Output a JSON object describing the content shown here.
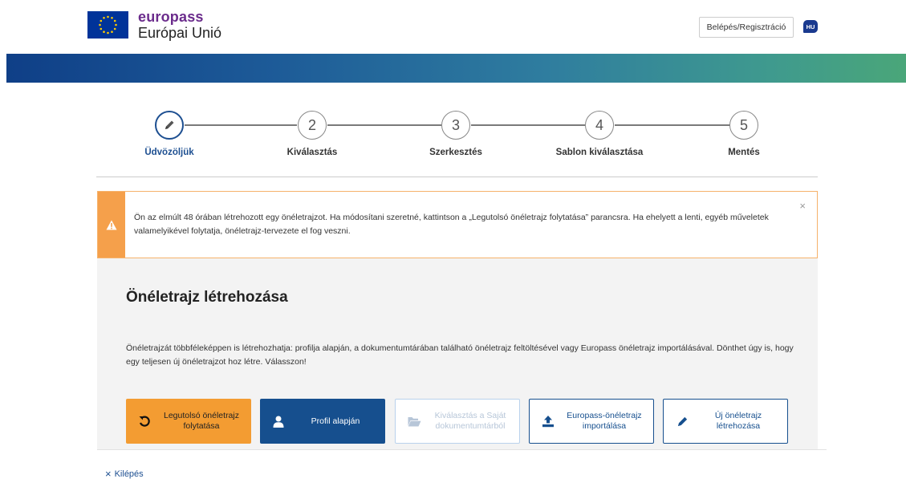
{
  "header": {
    "brand": "europass",
    "subtitle": "Európai Unió",
    "login_label": "Belépés/Regisztráció",
    "language": "HU"
  },
  "stepper": {
    "steps": [
      {
        "number": "",
        "label": "Üdvözöljük",
        "active": true
      },
      {
        "number": "2",
        "label": "Kiválasztás",
        "active": false
      },
      {
        "number": "3",
        "label": "Szerkesztés",
        "active": false
      },
      {
        "number": "4",
        "label": "Sablon kiválasztása",
        "active": false
      },
      {
        "number": "5",
        "label": "Mentés",
        "active": false
      }
    ]
  },
  "alert": {
    "text": "Ön az elmúlt 48 órában létrehozott egy önéletrajzot. Ha módosítani szeretné, kattintson a „Legutolsó önéletrajz folytatása” parancsra. Ha ehelyett a lenti, egyéb műveletek valamelyikével folytatja, önéletrajz-tervezete el fog veszni.",
    "close": "×"
  },
  "panel": {
    "title": "Önéletrajz létrehozása",
    "description": "Önéletrajzát többféleképpen is létrehozhatja: profilja alapján, a dokumentumtárában található önéletrajz feltöltésével vagy Europass önéletrajz importálásával. Dönthet úgy is, hogy egy teljesen új önéletrajzot hoz létre. Válasszon!",
    "options": {
      "continue": "Legutolsó önéletrajz folytatása",
      "profile": "Profil alapján",
      "library": "Kiválasztás a Saját dokumentumtárból",
      "import": "Europass-önéletrajz importálása",
      "new": "Új önéletrajz létrehozása"
    }
  },
  "footer": {
    "exit_icon": "×",
    "exit_label": "Kilépés"
  },
  "colors": {
    "brand_purple": "#6b2c8c",
    "primary_blue": "#164f8e",
    "warning_orange": "#f39c32"
  }
}
